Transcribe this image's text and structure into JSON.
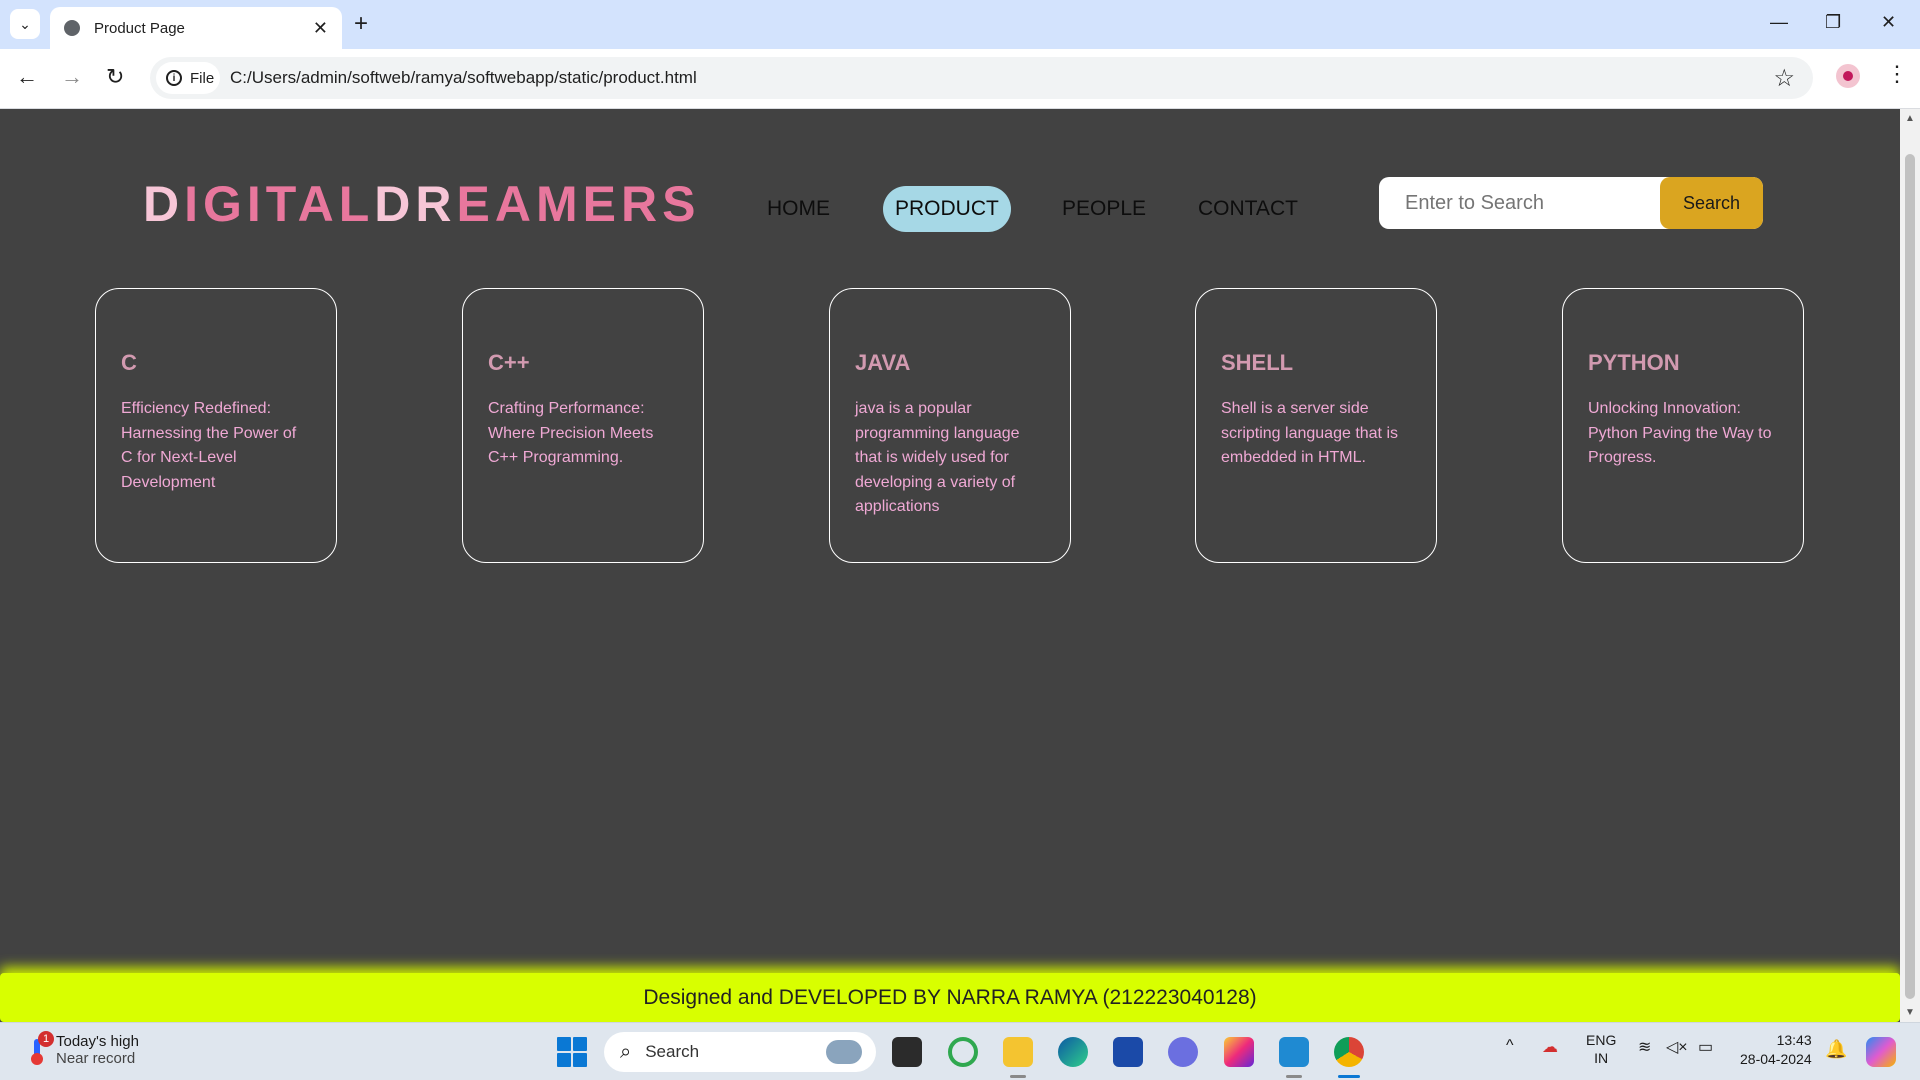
{
  "browser": {
    "tab_title": "Product Page",
    "tab_close": "✕",
    "new_tab": "+",
    "window_controls": {
      "minimize": "—",
      "restore": "❐",
      "close": "✕"
    },
    "nav": {
      "back": "←",
      "forward": "→",
      "reload": "↻"
    },
    "site_chip_label": "File",
    "site_chip_icon": "i",
    "url": "C:/Users/admin/softweb/ramya/softwebapp/static/product.html",
    "bookmark_icon": "☆",
    "menu_icon": "⋮"
  },
  "site": {
    "logo": {
      "part1": "D",
      "part2": "I",
      "part3": "GITAL",
      "part4": "DR",
      "part5": "EAMERS"
    },
    "nav": [
      {
        "label": "HOME",
        "active": false
      },
      {
        "label": "PRODUCT",
        "active": true
      },
      {
        "label": "PEOPLE",
        "active": false
      },
      {
        "label": "CONTACT",
        "active": false
      }
    ],
    "search": {
      "placeholder": "Enter to Search",
      "button_label": "Search"
    },
    "cards": [
      {
        "title": "C",
        "text": "Efficiency Redefined: Harnessing the Power of C for Next-Level Development"
      },
      {
        "title": "C++",
        "text": "Crafting Performance: Where Precision Meets C++ Programming."
      },
      {
        "title": "JAVA",
        "text": "java is a popular programming language that is widely used for developing a variety of applications"
      },
      {
        "title": "SHELL",
        "text": "Shell is a server side scripting language that is embedded in HTML."
      },
      {
        "title": "PYTHON",
        "text": "Unlocking Innovation: Python Paving the Way to Progress."
      }
    ],
    "footer": "Designed and DEVELOPED BY NARRA RAMYA (212223040128)"
  },
  "taskbar": {
    "weather": {
      "badge": "1",
      "line1": "Today's high",
      "line2": "Near record"
    },
    "search_label": "Search",
    "search_icon": "⌕",
    "tray_chevron": "^",
    "lang": {
      "line1": "ENG",
      "line2": "IN"
    },
    "clock": {
      "time": "13:43",
      "date": "28-04-2024"
    },
    "bell_icon": "🔔",
    "app_icons": [
      "task-view-icon",
      "circle-app-icon",
      "file-explorer-icon",
      "edge-icon",
      "store-icon",
      "vpn-icon",
      "instagram-icon",
      "vscode-icon",
      "chrome-icon"
    ]
  },
  "colors": {
    "page_bg": "#424242",
    "logo_pink": "#e8779d",
    "logo_light": "#f7c6d7",
    "active_nav": "#a6d8e6",
    "search_button": "#daa520",
    "footer_bg": "#d8ff00",
    "card_title": "#d29ab0",
    "card_text": "#f0a9d5"
  }
}
